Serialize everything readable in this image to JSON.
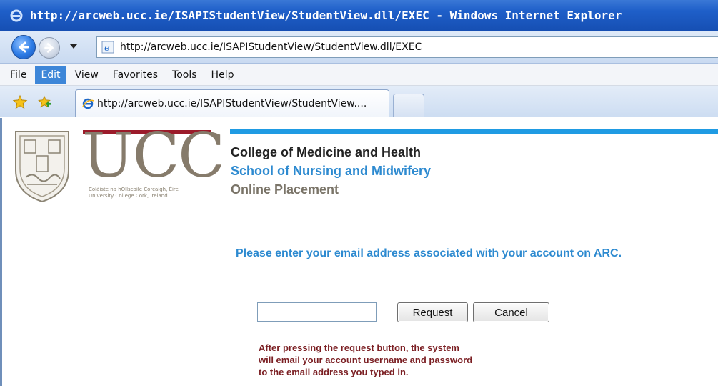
{
  "window": {
    "title": "http://arcweb.ucc.ie/ISAPIStudentView/StudentView.dll/EXEC - Windows Internet Explorer",
    "icon": "ie-icon"
  },
  "address_bar": {
    "url": "http://arcweb.ucc.ie/ISAPIStudentView/StudentView.dll/EXEC"
  },
  "menu": {
    "items": [
      {
        "label": "File",
        "active": false
      },
      {
        "label": "Edit",
        "active": true
      },
      {
        "label": "View",
        "active": false
      },
      {
        "label": "Favorites",
        "active": false
      },
      {
        "label": "Tools",
        "active": false
      },
      {
        "label": "Help",
        "active": false
      }
    ]
  },
  "tabs": {
    "active_label": "http://arcweb.ucc.ie/ISAPIStudentView/StudentView...."
  },
  "header": {
    "logo_text": "UCC",
    "logo_subtitle_1": "Coláiste na hOllscoile Corcaigh, Éire",
    "logo_subtitle_2": "University College Cork, Ireland",
    "college": "College of Medicine and Health",
    "school": "School of Nursing and Midwifery",
    "section": "Online Placement"
  },
  "form": {
    "instruction": "Please enter your email address associated with your account on ARC.",
    "email_value": "",
    "request_label": "Request",
    "cancel_label": "Cancel",
    "note_lines": [
      "After pressing the request button, the system",
      "will email your account username and password",
      "to the email address you typed in."
    ]
  },
  "colors": {
    "titlebar": "#1f5fc9",
    "accent_blue": "#2d8ad0",
    "rule_blue": "#1f9be3",
    "rule_red": "#9b1b2a",
    "note_red": "#7b1f23",
    "logo_grey": "#867b6b"
  }
}
